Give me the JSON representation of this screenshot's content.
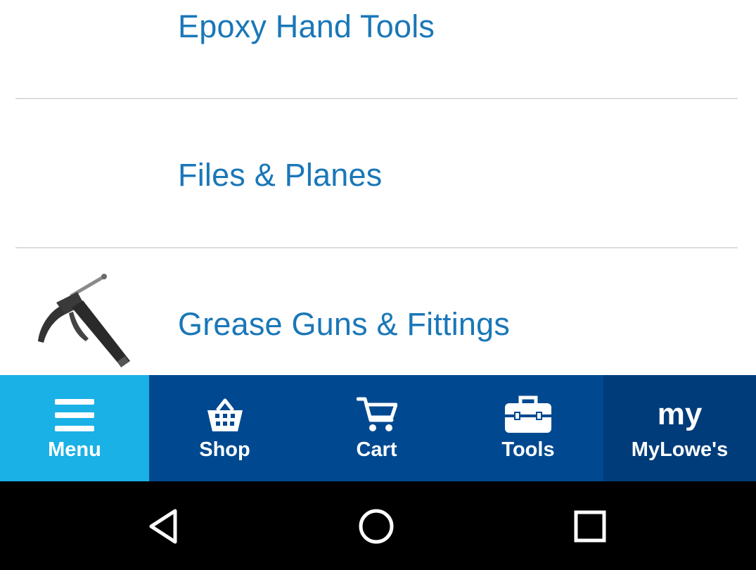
{
  "list": {
    "items": [
      {
        "label": "Epoxy Hand Tools"
      },
      {
        "label": "Files & Planes"
      },
      {
        "label": "Grease Guns & Fittings",
        "thumbnail_icon": "grease-gun"
      }
    ]
  },
  "bottom_nav": {
    "items": [
      {
        "label": "Menu",
        "icon": "hamburger-icon",
        "active": true
      },
      {
        "label": "Shop",
        "icon": "basket-icon"
      },
      {
        "label": "Cart",
        "icon": "cart-icon"
      },
      {
        "label": "Tools",
        "icon": "toolbox-icon"
      },
      {
        "label": "MyLowe's",
        "icon_text": "my"
      }
    ]
  },
  "system_nav": {
    "buttons": [
      "back-icon",
      "home-icon",
      "recents-icon"
    ]
  },
  "colors": {
    "link_text": "#1a77b8",
    "nav_bg": "#004990",
    "nav_active_bg": "#1ab1e6",
    "nav_my_bg": "#003c7a",
    "system_bar": "#000000"
  }
}
